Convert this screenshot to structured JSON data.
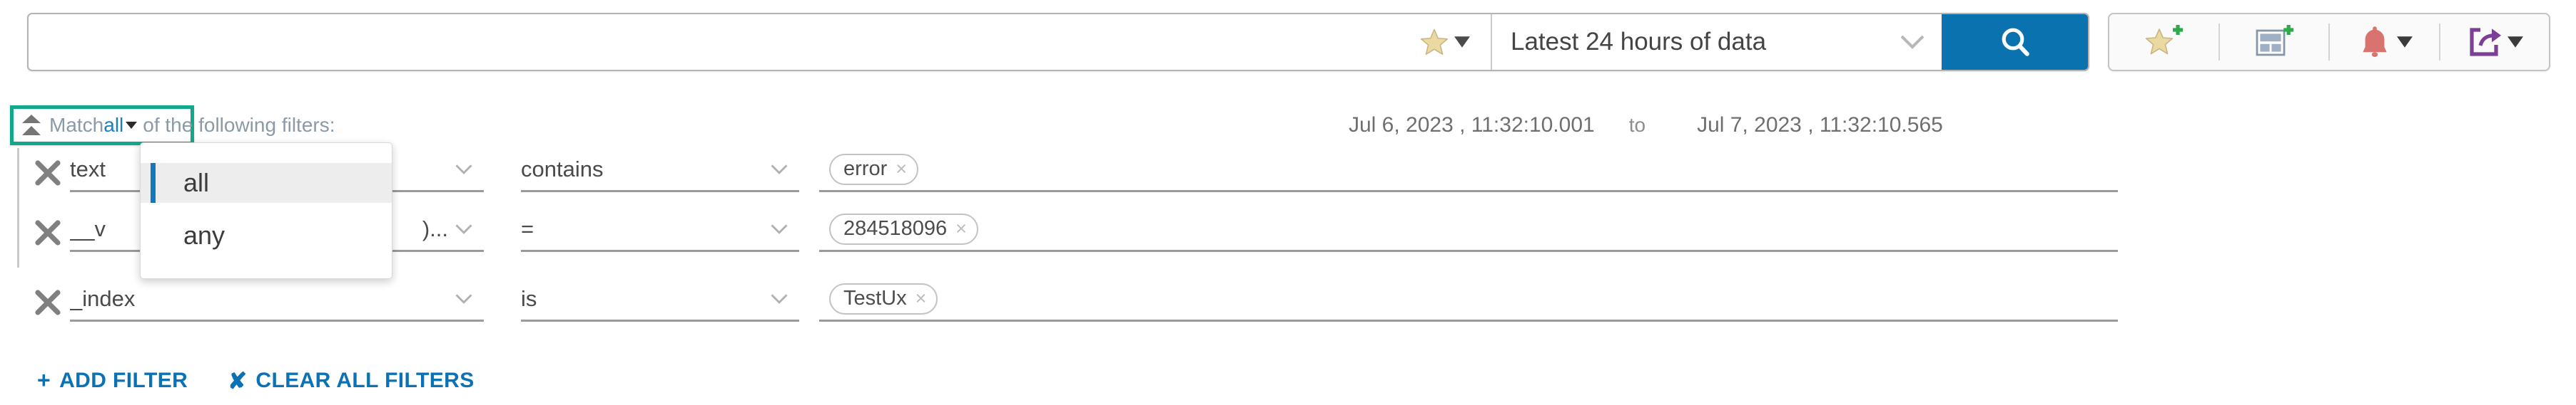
{
  "search": {
    "query_value": "",
    "placeholder": "",
    "favorite_icon": "star-icon",
    "time_range_label": "Latest 24 hours of data",
    "go_icon": "search-icon"
  },
  "toolbar": {
    "buttons": [
      {
        "name": "add-favorite-button",
        "icon": "star-plus-icon"
      },
      {
        "name": "add-to-dashboard-button",
        "icon": "dashboard-plus-icon"
      },
      {
        "name": "alerts-button",
        "icon": "bell-icon"
      },
      {
        "name": "share-export-button",
        "icon": "share-icon"
      }
    ]
  },
  "match_bar": {
    "collapse_icon": "collapse-up-icon",
    "prefix": "Match",
    "value": "all",
    "suffix": "of the following filters:"
  },
  "match_dropdown": {
    "open": true,
    "options": [
      {
        "label": "all",
        "selected": true
      },
      {
        "label": "any",
        "selected": false
      }
    ]
  },
  "date_range": {
    "from": "Jul 6, 2023 , 11:32:10.001",
    "separator": "to",
    "to": "Jul 7, 2023 , 11:32:10.565"
  },
  "filters": [
    {
      "remove_icon": "close-icon",
      "field": "text",
      "operator": "contains",
      "values": [
        {
          "label": "error",
          "remove_icon": "close-icon"
        }
      ]
    },
    {
      "remove_icon": "close-icon",
      "field": "__v",
      "field_truncated_tail": ")...",
      "operator": "=",
      "values": [
        {
          "label": "284518096",
          "remove_icon": "close-icon"
        }
      ]
    },
    {
      "remove_icon": "close-icon",
      "field": "_index",
      "operator": "is",
      "values": [
        {
          "label": "TestUx",
          "remove_icon": "close-icon"
        }
      ]
    }
  ],
  "actions": {
    "add_filter_symbol": "+",
    "add_filter_label": "ADD FILTER",
    "clear_all_symbol": "✘",
    "clear_all_label": "CLEAR ALL FILTERS"
  },
  "colors": {
    "accent_blue": "#0a72ae",
    "link_blue": "#0b72b5",
    "highlight_green": "#14a88a",
    "star_gold": "#ead9a0",
    "bell_red": "#d9736f",
    "share_purple": "#7b3f98",
    "plus_green": "#2cab4a"
  }
}
